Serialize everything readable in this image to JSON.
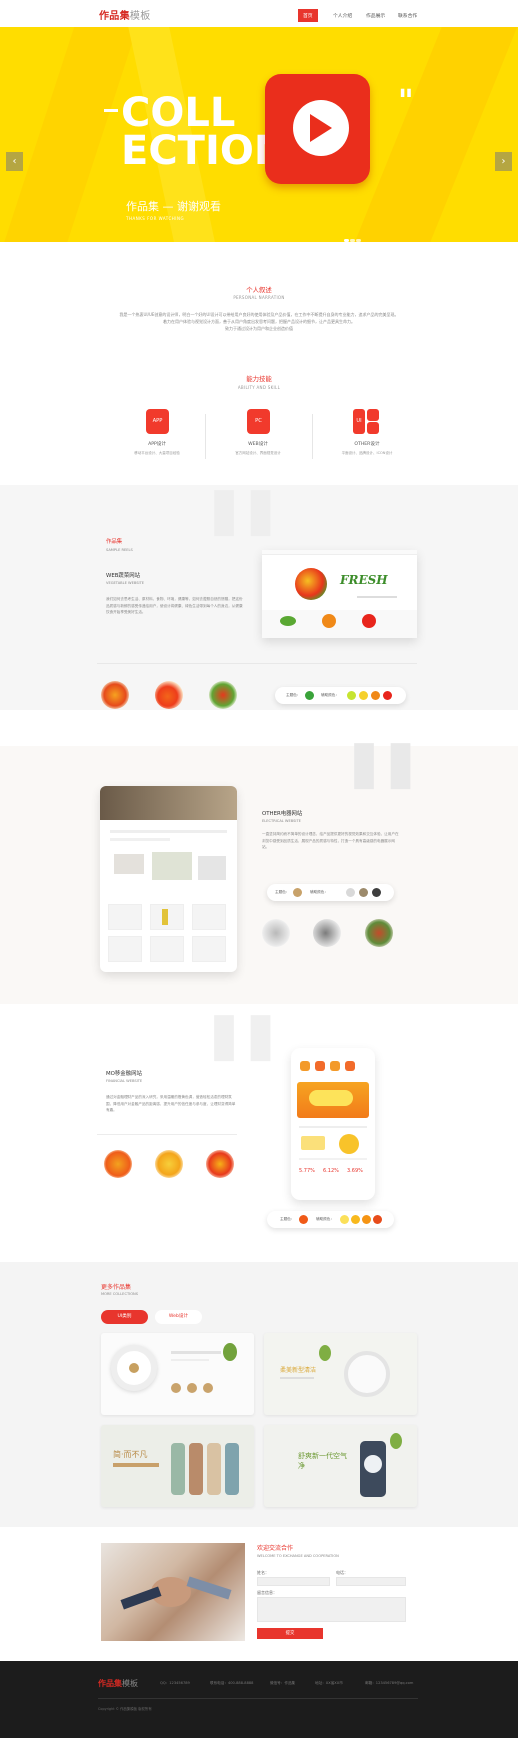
{
  "nav": {
    "logo_main": "作品集",
    "logo_sub": "模板",
    "items": [
      "首页",
      "个人介绍",
      "作品展示",
      "联系合作"
    ]
  },
  "hero": {
    "title_line1": "COLL",
    "title_line2": "ECTION",
    "quote_mark": "\"",
    "subtitle_cn": "作品集 — 谢谢观看",
    "subtitle_en": "THANKS FOR WATCHING",
    "prev_icon": "‹",
    "next_icon": "›",
    "slides": 3
  },
  "narration": {
    "title": "个人叙述",
    "subtitle": "PERSONAL NARRATION",
    "lines": [
      "我是一个热衷UI/UE创意的设计师，明白一个好的UI设计可以带给用户良好的使用体验及产品价值，在工作中不断提升自身的专业能力，追求产品的完美呈现。",
      "着力在用户体验与视觉设计方面，善于从用户角度出发思考问题，把握产品设计的细节，让产品更具生命力。",
      "致力于通过设计为用户和企业创造价值"
    ]
  },
  "ability": {
    "title": "能力技能",
    "subtitle": "ABILITY AND SKILL",
    "items": [
      {
        "icon": "APP",
        "label": "APP设计",
        "desc": "移动平台设计、大量项目经验"
      },
      {
        "icon": "PC",
        "label": "WEB设计",
        "desc": "官方网站设计、界面视觉设计"
      },
      {
        "icon": "UI",
        "label": "OTHER设计",
        "desc": "平面设计、品牌设计、ICON设计"
      }
    ]
  },
  "work1": {
    "label": "作品集",
    "label_en": "SAMPLE REELS",
    "title": "WEB蔬菜网站",
    "title_en": "VEGETABLE WEBSITE",
    "desc": "我们如何去思考生活、原材料、食物、环境，健康等，如何去遵照自然的馈赠，把这份品质感与新鲜的感受传递给用户，使设计将健康、绿色生活带到每个人的身边，从健康饮食开始享受美好生活。",
    "mock_word": "FRESH",
    "main_color_label": "主题色：",
    "aux_color_label": "辅助颜色：",
    "main_color": "#3aa33a",
    "aux_colors": [
      "#c6e431",
      "#f5d02d",
      "#f08918",
      "#e8251c"
    ]
  },
  "work2": {
    "title": "OTHER电器网站",
    "title_en": "ELECTRICAL WEBSITE",
    "desc": "一直坚持简约而不简单的设计理念，给产品提供更好的视觉效果和交互体验，让用户在浏览中感受到品质生活，展现产品的质感与特性，打造一个具有高级感的电器展示网站。",
    "main_color_label": "主题色：",
    "aux_color_label": "辅助颜色：",
    "main_color": "#c8a26a",
    "aux_colors": [
      "#d9d9d9",
      "#9c8a6b",
      "#3e3e3e"
    ]
  },
  "work3": {
    "title": "MO移金融网站",
    "title_en": "FINANCIAL WEBSITE",
    "desc": "通过对金融理财产品的深入研究，采用温暖的橙黄色调，营造轻松活泼的理财氛围，降低用户对金融产品的距离感，提升用户的信任度与参与度，让理财变得简单有趣。",
    "main_color_label": "主题色：",
    "aux_color_label": "辅助颜色：",
    "main_color": "#f05a18",
    "aux_colors": [
      "#fbe05a",
      "#f8b91d",
      "#f59414",
      "#e74c1b"
    ],
    "stats": [
      "5.77%",
      "6.12%",
      "3.69%"
    ]
  },
  "more": {
    "title": "更多作品集",
    "subtitle": "MORE COLLECTIONS",
    "tab_active": "UI类别",
    "tab_other": "Web设计",
    "card2_title": "柔美新型清洁",
    "card3_title": "简·而不凡",
    "card4_title": "舒爽新一代空气净"
  },
  "contact": {
    "title": "欢迎交流合作",
    "subtitle": "WELCOME TO EXCHANGE AND COOPERATION",
    "name_label": "姓名：",
    "phone_label": "电话：",
    "message_label": "留言信息：",
    "submit": "提交"
  },
  "footer": {
    "logo_main": "作品集",
    "logo_sub": "模板",
    "items": [
      "QQ：123456789",
      "联系电话：400-888-8888",
      "微信号：作品集",
      "地址：XX省XX市",
      "邮箱：123456789@qq.com"
    ],
    "copyright": "Copyright © 作品集模板 版权所有"
  }
}
